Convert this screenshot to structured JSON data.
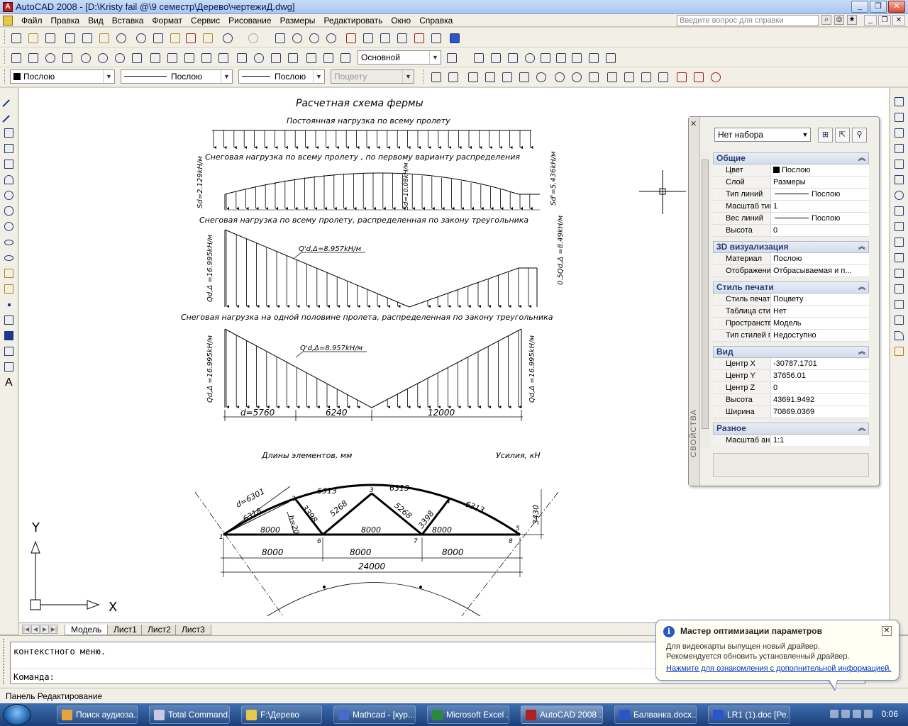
{
  "window": {
    "title": "AutoCAD 2008 - [D:\\Kristy fail @\\9 семестр\\Дерево\\чертежиД.dwg]",
    "buttons": [
      "_",
      "❐",
      "✕"
    ]
  },
  "menu": {
    "items": [
      "Файл",
      "Правка",
      "Вид",
      "Вставка",
      "Формат",
      "Сервис",
      "Рисование",
      "Размеры",
      "Редактировать",
      "Окно",
      "Справка"
    ],
    "help_placeholder": "Введите вопрос для справки"
  },
  "toolbars": {
    "text_style": "Основной",
    "layer_color": "Послою",
    "linetype": "Послою",
    "lineweight": "Послою",
    "plotstyle": "Поцвету"
  },
  "drawing": {
    "title": "Расчетная схема фермы",
    "load1": "Постоянная нагрузка по всему пролету",
    "load2": "Снеговая нагрузка по всему пролету , по первому варианту распределения",
    "load2_left": "Sd=2.129kH/м",
    "load2_mid": "Sd=10.08kH/м",
    "load2_right": "Sd'=5.436kH/м",
    "load3": "Снеговая нагрузка по всему пролету, распределенная по закону треугольника",
    "load3_left": "Qd,Δ =16.995kH/м",
    "load3_mid": "Q'd,Δ=8.957kH/м",
    "load3_right": "0.5Qd,Δ =8.49kH/м",
    "load4": "Снеговая нагрузка на одной половине пролета, распределенная по закону треугольника",
    "load4_left": "Qd,Δ =16.995kH/м",
    "load4_mid": "Q'd,Δ=8.957kH/м",
    "load4_right": "Qd,Δ =16.995kH/м",
    "dim_d": "d=5760",
    "dim_6240": "6240",
    "dim_12000": "12000",
    "lengths_label": "Длины элементов, мм",
    "forces_label": "Усилия, кН",
    "truss": {
      "d_6301": "d=6301",
      "top_6313a": "6313",
      "top_6313b": "6313",
      "top_6313c": "6313",
      "left_6318": "6318",
      "diag_3398a": "3398",
      "diag_5268a": "5268",
      "diag_5268b": "5268",
      "diag_3398b": "3398",
      "h_20": "h=20",
      "bot_8000a": "8000",
      "bot_8000b": "8000",
      "bot_8000c": "8000",
      "height_3430": "3430",
      "dim_8000a": "8000",
      "dim_8000b": "8000",
      "dim_8000c": "8000",
      "dim_24000": "24000",
      "nodes": [
        "1",
        "2",
        "3",
        "4",
        "5",
        "6",
        "7",
        "8"
      ]
    },
    "ucs_y": "Y",
    "ucs_x": "X"
  },
  "layout_tabs": [
    "Модель",
    "Лист1",
    "Лист2",
    "Лист3"
  ],
  "properties": {
    "selection": "Нет набора",
    "palette_label": "СВОЙСТВА",
    "groups": [
      {
        "name": "Общие",
        "rows": [
          {
            "k": "Цвет",
            "v": "Послою",
            "swatch": true
          },
          {
            "k": "Слой",
            "v": "Размеры"
          },
          {
            "k": "Тип линий",
            "v": "Послою",
            "line": true
          },
          {
            "k": "Масштаб тип...",
            "v": "1"
          },
          {
            "k": "Вес линий",
            "v": "Послою",
            "line": true
          },
          {
            "k": "Высота",
            "v": "0"
          }
        ]
      },
      {
        "name": "3D визуализация",
        "rows": [
          {
            "k": "Материал",
            "v": "Послою"
          },
          {
            "k": "Отображени...",
            "v": "Отбрасываемая и п..."
          }
        ]
      },
      {
        "name": "Стиль печати",
        "rows": [
          {
            "k": "Стиль печати",
            "v": "Поцвету"
          },
          {
            "k": "Таблица сти...",
            "v": "Нет"
          },
          {
            "k": "Пространств...",
            "v": "Модель"
          },
          {
            "k": "Тип стилей п...",
            "v": "Недоступно"
          }
        ]
      },
      {
        "name": "Вид",
        "rows": [
          {
            "k": "Центр X",
            "v": "-30787.1701"
          },
          {
            "k": "Центр Y",
            "v": "37656.01"
          },
          {
            "k": "Центр Z",
            "v": "0"
          },
          {
            "k": "Высота",
            "v": "43691.9492"
          },
          {
            "k": "Ширина",
            "v": "70869.0369"
          }
        ]
      },
      {
        "name": "Разное",
        "rows": [
          {
            "k": "Масштаб анн...",
            "v": "1:1"
          }
        ]
      }
    ]
  },
  "command": {
    "history": "контекстного меню.",
    "prompt": "Команда:"
  },
  "status": "Панель Редактирование",
  "balloon": {
    "title": "Мастер оптимизации параметров",
    "line1": "Для видеокарты выпущен новый драйвер.",
    "line2": "Рекомендуется обновить установленный драйвер.",
    "link": "Нажмите для ознакомления с дополнительной информацией."
  },
  "taskbar": {
    "tasks": [
      {
        "label": "Поиск аудиоза...",
        "color": "#e8a33a"
      },
      {
        "label": "Total Command...",
        "color": "#c8c8e8"
      },
      {
        "label": "F:\\Дерево",
        "color": "#e8c84a"
      },
      {
        "label": "Mathcad - [кур...",
        "color": "#4a6ac8"
      },
      {
        "label": "Microsoft Excel ...",
        "color": "#2a8a3a"
      },
      {
        "label": "AutoCAD 2008 ...",
        "color": "#b02020"
      },
      {
        "label": "Балванка.docx...",
        "color": "#2a56c8"
      },
      {
        "label": "LR1 (1).doc [Ре...",
        "color": "#2a56c8"
      }
    ],
    "clock": "0:06"
  }
}
